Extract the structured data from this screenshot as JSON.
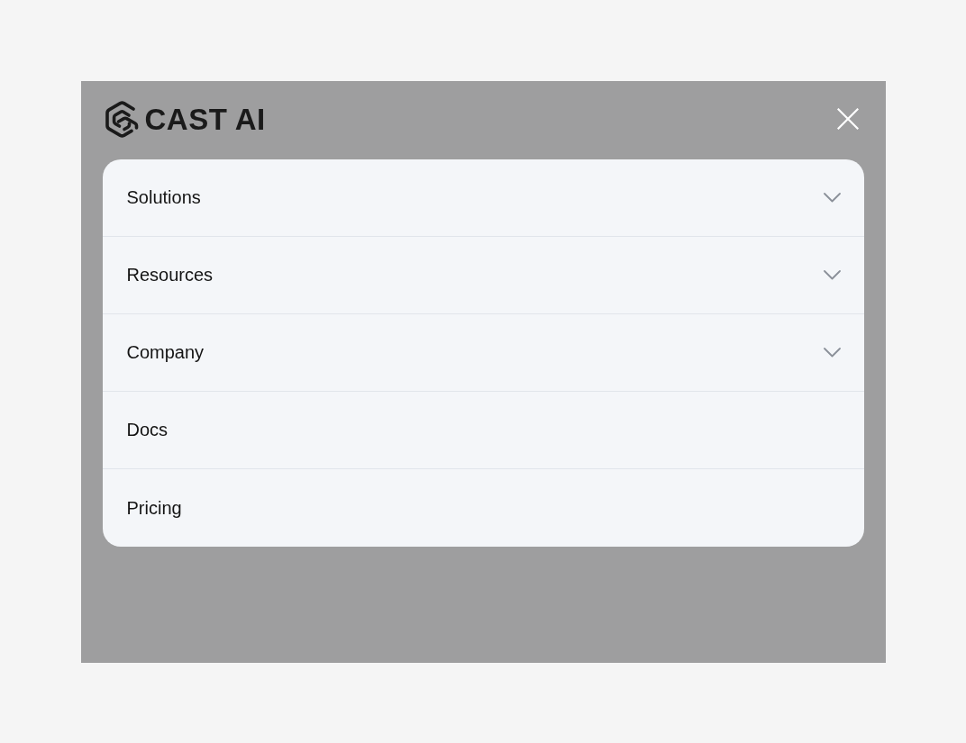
{
  "header": {
    "logo_text": "CAST AI"
  },
  "menu": {
    "items": [
      {
        "label": "Solutions",
        "kind": "dropdown"
      },
      {
        "label": "Resources",
        "kind": "dropdown"
      },
      {
        "label": "Company",
        "kind": "dropdown"
      },
      {
        "label": "Docs",
        "kind": "link"
      },
      {
        "label": "Pricing",
        "kind": "link"
      }
    ]
  }
}
